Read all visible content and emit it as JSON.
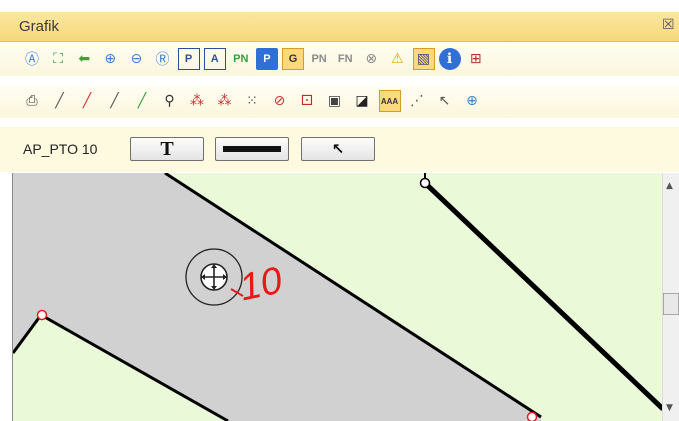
{
  "window": {
    "title": "Grafik",
    "close_glyph": "☒"
  },
  "toolbar1": [
    {
      "name": "zoom-a-icon",
      "glyph": "Ⓐ",
      "color": "#3b7fd1"
    },
    {
      "name": "zoom-extent-icon",
      "glyph": "⛶",
      "color": "#2ea33b"
    },
    {
      "name": "back-arrow-icon",
      "glyph": "⬅",
      "color": "#3aa33b"
    },
    {
      "name": "zoom-in-icon",
      "glyph": "⊕",
      "color": "#3b7fd1"
    },
    {
      "name": "zoom-out-icon",
      "glyph": "⊖",
      "color": "#3b7fd1"
    },
    {
      "name": "zoom-r-icon",
      "glyph": "Ⓡ",
      "color": "#3b7fd1"
    },
    {
      "name": "frame-p-icon",
      "glyph": "P",
      "color": "#2a4f9e",
      "text": true
    },
    {
      "name": "frame-a-icon",
      "glyph": "A",
      "color": "#2a4f9e",
      "text": true
    },
    {
      "name": "pn-icon",
      "glyph": "PN",
      "color": "#2ea33b",
      "text": true
    },
    {
      "name": "parking-p-icon",
      "glyph": "P",
      "color": "#ffffff",
      "bg": "#2f6fd6",
      "text": true
    },
    {
      "name": "frame-g-icon",
      "glyph": "G",
      "color": "#333333",
      "text": true,
      "selected": true
    },
    {
      "name": "pn-gray-icon",
      "glyph": "PN",
      "color": "#8a8a8a",
      "text": true
    },
    {
      "name": "fn-gray-icon",
      "glyph": "FN",
      "color": "#8a8a8a",
      "text": true
    },
    {
      "name": "cancel-circle-icon",
      "glyph": "⊗",
      "color": "#8a8a8a"
    },
    {
      "name": "warning-icon",
      "glyph": "⚠",
      "color": "#e0a800"
    },
    {
      "name": "hatch-icon",
      "glyph": "▧",
      "color": "#4a4a7a",
      "selected": true
    },
    {
      "name": "info-icon",
      "glyph": "ℹ",
      "color": "#ffffff",
      "bg": "#2f6fd6"
    },
    {
      "name": "grid-dots-icon",
      "glyph": "⊞",
      "color": "#b03030"
    }
  ],
  "toolbar2": [
    {
      "name": "print-icon",
      "glyph": "⎙",
      "color": "#444444"
    },
    {
      "name": "line-icon",
      "glyph": "╱",
      "color": "#555555"
    },
    {
      "name": "line-delete-icon",
      "glyph": "╱",
      "color": "#d23030"
    },
    {
      "name": "line-move-icon",
      "glyph": "╱",
      "color": "#555555"
    },
    {
      "name": "line-add-icon",
      "glyph": "╱",
      "color": "#2ea33b"
    },
    {
      "name": "binoculars-icon",
      "glyph": "⚲",
      "color": "#333333"
    },
    {
      "name": "points-red-icon",
      "glyph": "⁂",
      "color": "#cc3333"
    },
    {
      "name": "points-move-icon",
      "glyph": "⁂",
      "color": "#cc3333"
    },
    {
      "name": "dot-grid-icon",
      "glyph": "⁙",
      "color": "#555555"
    },
    {
      "name": "no-draw-icon",
      "glyph": "⊘",
      "color": "#cc3333"
    },
    {
      "name": "traffic-light-icon",
      "glyph": "⚀",
      "color": "#c62828"
    },
    {
      "name": "point-square-icon",
      "glyph": "▣",
      "color": "#444444"
    },
    {
      "name": "contrast-icon",
      "glyph": "◪",
      "color": "#222222"
    },
    {
      "name": "text-aaa-icon",
      "glyph": "AAA",
      "color": "#333333",
      "text": true,
      "selected": true
    },
    {
      "name": "hatch-toggle-icon",
      "glyph": "⋰",
      "color": "#555555"
    },
    {
      "name": "pointer-icon",
      "glyph": "↖",
      "color": "#555555"
    },
    {
      "name": "add-layer-icon",
      "glyph": "⊕",
      "color": "#3b7fd1"
    }
  ],
  "cmdbar": {
    "label": "AP_PTO 10",
    "text_button_glyph": "T",
    "arrow_button_glyph": "↖"
  },
  "map": {
    "label": "10",
    "label_color": "#e8181a",
    "parcel_color": "#d1d1d1",
    "background_color": "#eaf9d7"
  }
}
